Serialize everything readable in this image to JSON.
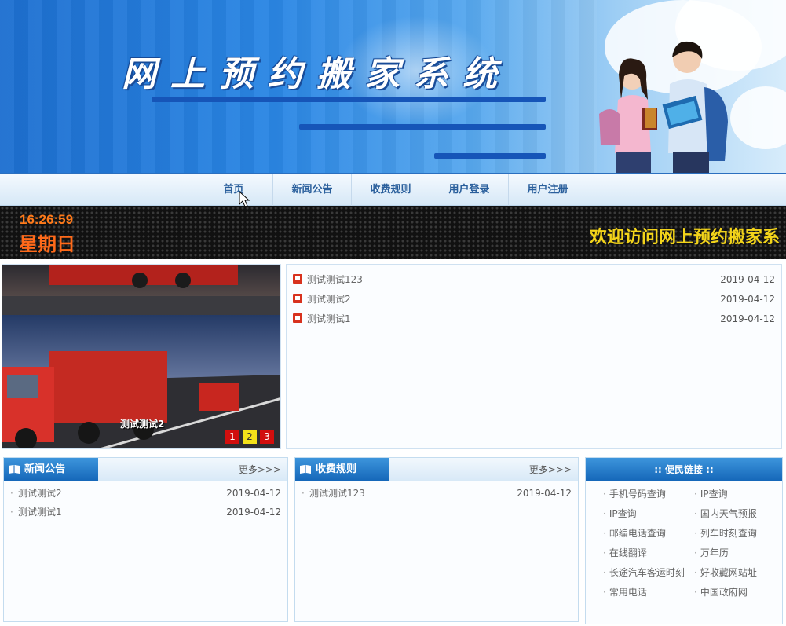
{
  "banner": {
    "title": "网上预约搬家系统"
  },
  "nav": {
    "items": [
      "首页",
      "新闻公告",
      "收费规则",
      "用户登录",
      "用户注册"
    ]
  },
  "status": {
    "time": "16:26:59",
    "weekday": "星期日",
    "marquee": "欢迎访问网上预约搬家系"
  },
  "slider": {
    "caption": "测试测试2",
    "dots": [
      "1",
      "2",
      "3"
    ],
    "active_dot": 2
  },
  "latest": [
    {
      "title": "测试测试123",
      "date": "2019-04-12"
    },
    {
      "title": "测试测试2",
      "date": "2019-04-12"
    },
    {
      "title": "测试测试1",
      "date": "2019-04-12"
    }
  ],
  "news": {
    "title": "新闻公告",
    "more": "更多>>>",
    "items": [
      {
        "title": "测试测试2",
        "date": "2019-04-12"
      },
      {
        "title": "测试测试1",
        "date": "2019-04-12"
      }
    ]
  },
  "fees": {
    "title": "收费规则",
    "more": "更多>>>",
    "items": [
      {
        "title": "测试测试123",
        "date": "2019-04-12"
      }
    ]
  },
  "links": {
    "title": ":: 便民链接 ::",
    "items": [
      "手机号码查询",
      "IP查询",
      "IP查询",
      "国内天气预报",
      "邮编电话查询",
      "列车时刻查询",
      "在线翻译",
      "万年历",
      "长途汽车客运时刻",
      "好收藏网站址",
      "常用电话",
      "中国政府网"
    ]
  },
  "colors": {
    "brand": "#1466b8",
    "nav_text": "#2a5f9c",
    "clock": "#ff7a1a",
    "marquee": "#f3d41a",
    "slide_dot": "#d10e0e",
    "slide_dot_active": "#f2e21a"
  }
}
